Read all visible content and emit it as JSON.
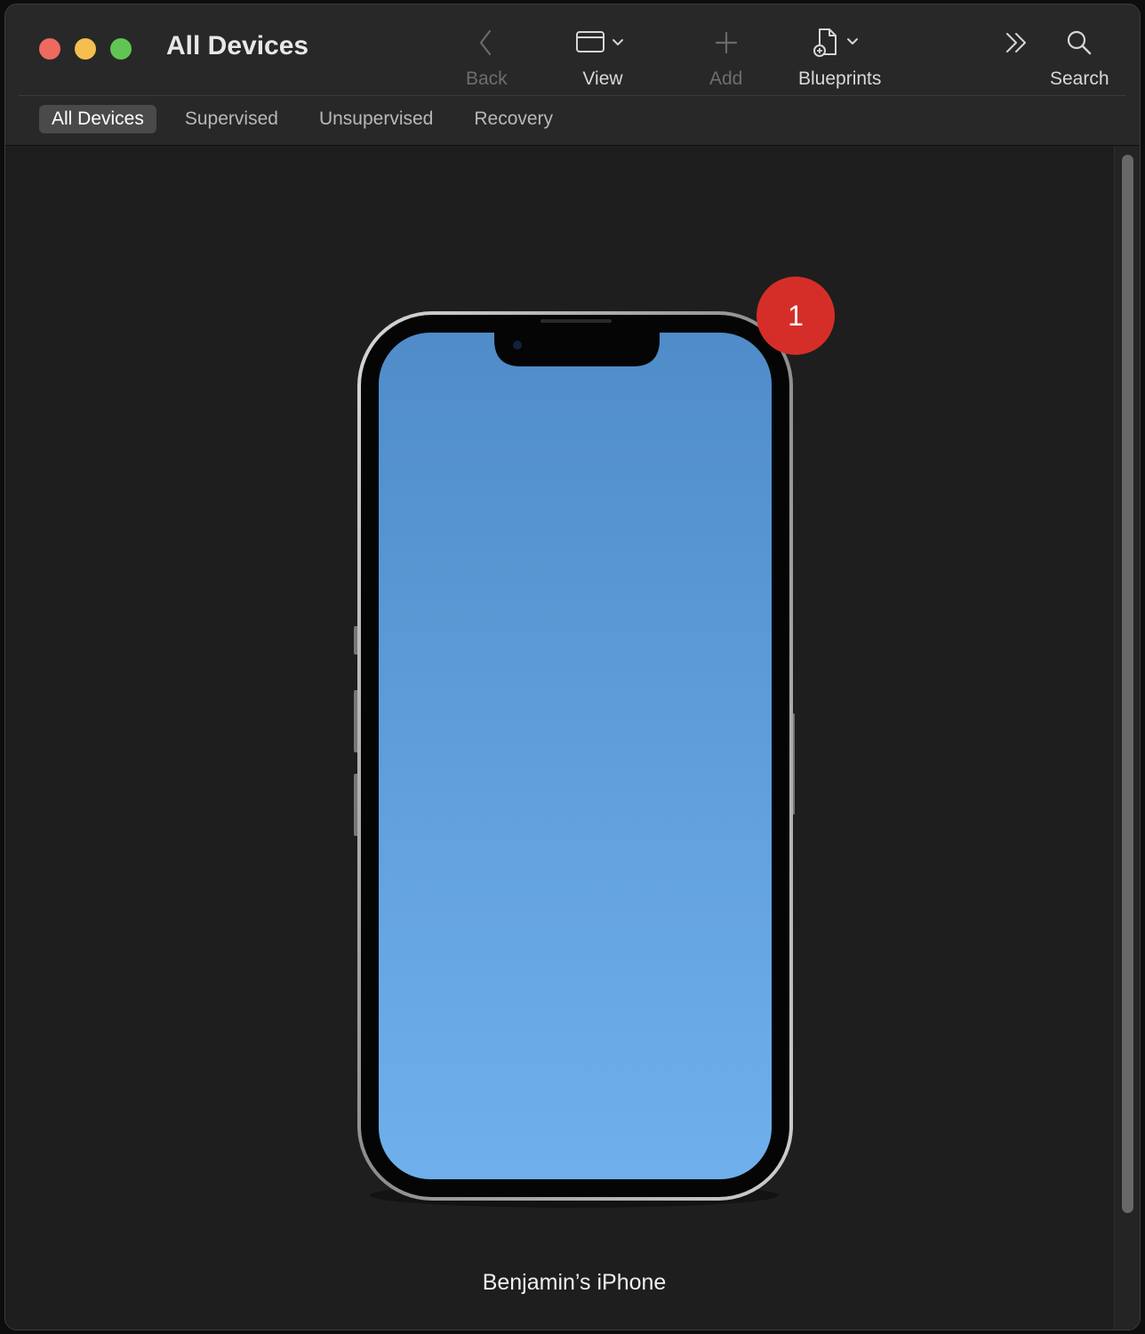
{
  "window": {
    "title": "All Devices",
    "traffic_lights": {
      "close_color": "#ed6a5e",
      "minimize_color": "#f4bf4f",
      "zoom_color": "#61c554"
    }
  },
  "toolbar": {
    "back_label": "Back",
    "view_label": "View",
    "add_label": "Add",
    "blueprints_label": "Blueprints",
    "search_label": "Search"
  },
  "tabs": [
    {
      "label": "All Devices",
      "selected": true
    },
    {
      "label": "Supervised",
      "selected": false
    },
    {
      "label": "Unsupervised",
      "selected": false
    },
    {
      "label": "Recovery",
      "selected": false
    }
  ],
  "device": {
    "name": "Benjamin’s iPhone",
    "badge_count": "1",
    "badge_color": "#d52e28",
    "screen_gradient": [
      "#4f8cc9",
      "#6fb0ec"
    ]
  }
}
